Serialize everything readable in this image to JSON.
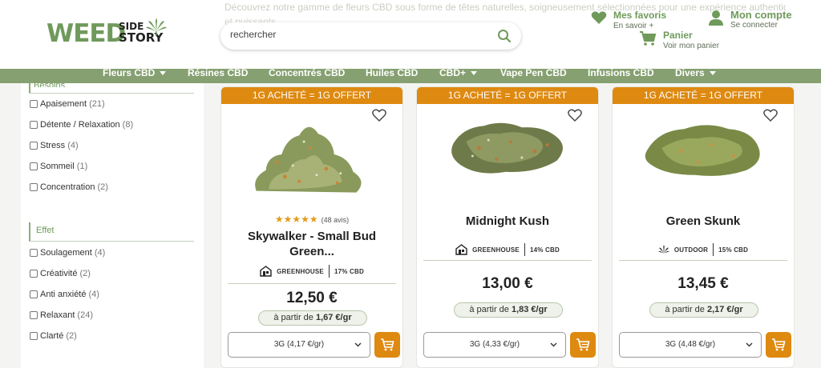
{
  "header": {
    "ghost_line": "Découvrez notre gamme de fleurs CBD sous forme de têtes naturelles, soigneusement sélectionnées pour une expérience authentique avec des arômes riches",
    "ghost_line2": "et puissants.",
    "logo_weed": "WEED",
    "logo_side": "SIDE",
    "logo_story": "STORY",
    "search_placeholder": "rechercher",
    "favorites": {
      "title": "Mes favoris",
      "sub": "En savoir +"
    },
    "account": {
      "title": "Mon compte",
      "sub": "Se connecter"
    },
    "cart": {
      "title": "Panier",
      "sub": "Voir mon panier"
    }
  },
  "nav": [
    {
      "label": "Fleurs CBD",
      "caret": true
    },
    {
      "label": "Résines CBD",
      "caret": false
    },
    {
      "label": "Concentrés CBD",
      "caret": false
    },
    {
      "label": "Huiles CBD",
      "caret": false
    },
    {
      "label": "CBD+",
      "caret": true
    },
    {
      "label": "Vape Pen CBD",
      "caret": false
    },
    {
      "label": "Infusions CBD",
      "caret": false
    },
    {
      "label": "Divers",
      "caret": true
    }
  ],
  "sidebar": {
    "top_section_cut": "Besoins",
    "needs": [
      {
        "label": "Apaisement",
        "count": "(21)"
      },
      {
        "label": "Détente / Relaxation",
        "count": "(8)"
      },
      {
        "label": "Stress",
        "count": "(4)"
      },
      {
        "label": "Sommeil",
        "count": "(1)"
      },
      {
        "label": "Concentration",
        "count": "(2)"
      }
    ],
    "effect_title": "Effet",
    "effects": [
      {
        "label": "Soulagement",
        "count": "(4)"
      },
      {
        "label": "Créativité",
        "count": "(2)"
      },
      {
        "label": "Anti anxiété",
        "count": "(4)"
      },
      {
        "label": "Relaxant",
        "count": "(24)"
      },
      {
        "label": "Clarté",
        "count": "(2)"
      }
    ]
  },
  "products": [
    {
      "promo": "1G ACHETÉ = 1G OFFERT",
      "stars": "★★★★★",
      "reviews": "(48 avis)",
      "name_line1": "Skywalker - Small Bud",
      "name_line2": "Green...",
      "culture": "GREENHOUSE",
      "cbd": "17% CBD",
      "price": "12,50 €",
      "ppg_prefix": "à partir de",
      "ppg_value": "1,67 €/gr",
      "option": "3G (4,17 €/gr)"
    },
    {
      "promo": "1G ACHETÉ = 1G OFFERT",
      "name_line1": "Midnight Kush",
      "culture": "GREENHOUSE",
      "cbd": "14% CBD",
      "price": "13,00 €",
      "ppg_prefix": "à partir de",
      "ppg_value": "1,83 €/gr",
      "option": "3G (4,33 €/gr)"
    },
    {
      "promo": "1G ACHETÉ = 1G OFFERT",
      "name_line1": "Green Skunk",
      "culture": "OUTDOOR",
      "cbd": "15% CBD",
      "price": "13,45 €",
      "ppg_prefix": "à partir de",
      "ppg_value": "2,17 €/gr",
      "option": "3G (4,48 €/gr)"
    }
  ],
  "colors": {
    "brand_green": "#6f9a5b",
    "nav_green": "#86a071",
    "promo_orange": "#de8910",
    "star_orange": "#e39a1a"
  }
}
